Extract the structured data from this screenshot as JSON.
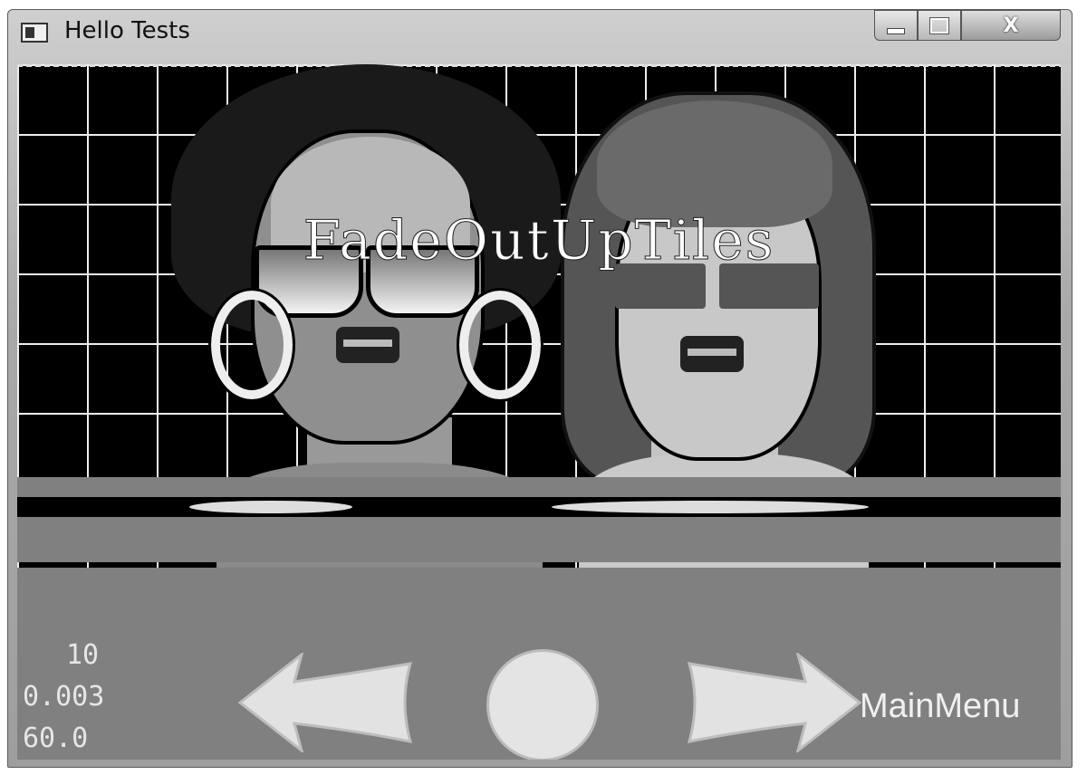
{
  "window": {
    "title": "Hello Tests",
    "close_label": "X"
  },
  "scene": {
    "effect_name": "FadeOutUpTiles"
  },
  "stats": {
    "line1": "10",
    "line2": "0.003",
    "line3": "60.0"
  },
  "menu": {
    "main_menu_label": "MainMenu"
  }
}
